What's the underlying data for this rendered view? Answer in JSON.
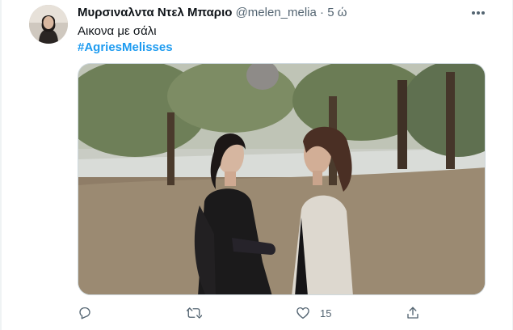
{
  "tweet": {
    "author_name": "Μυρσιναλντα Ντελ Μπαριο",
    "handle": "@melen_melia",
    "separator": "·",
    "time": "5 ώ",
    "text": "Αικονα με σάλι",
    "hashtag": "#AgriesMelisses"
  },
  "actions": {
    "reply": {
      "icon": "reply-icon",
      "count": ""
    },
    "retweet": {
      "icon": "retweet-icon",
      "count": ""
    },
    "like": {
      "icon": "heart-icon",
      "count": "15"
    },
    "share": {
      "icon": "share-icon",
      "count": ""
    }
  },
  "colors": {
    "accent": "#1d9bf0",
    "secondary_text": "#536471",
    "primary_text": "#0f1419"
  }
}
